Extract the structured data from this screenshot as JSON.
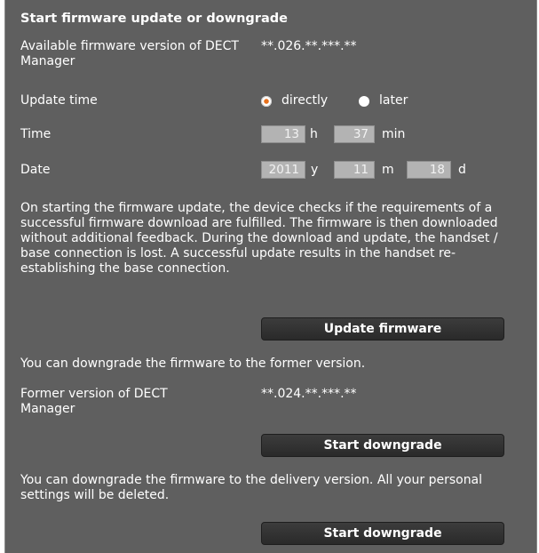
{
  "title": "Start firmware update or downgrade",
  "available_label": "Available firmware version of DECT Manager",
  "available_value": "**.026.**.***.**",
  "update_time": {
    "label": "Update time",
    "options": [
      {
        "label": "directly",
        "checked": true
      },
      {
        "label": "later",
        "checked": false
      }
    ]
  },
  "time": {
    "label": "Time",
    "hours": "13",
    "hours_unit": "h",
    "minutes": "37",
    "minutes_unit": "min"
  },
  "date": {
    "label": "Date",
    "year": "2011",
    "year_unit": "y",
    "month": "11",
    "month_unit": "m",
    "day": "18",
    "day_unit": "d"
  },
  "info_text": "On starting the firmware update, the device checks if the requirements of a successful firmware download are fulfilled. The firmware is then downloaded without additional feedback. During the download and update, the handset / base connection is lost. A successful update results in the handset re-establishing the base connection.",
  "update_button": "Update firmware",
  "downgrade_former_text": "You can downgrade the firmware to the former version.",
  "former_label": "Former version of DECT Manager",
  "former_value": "**.024.**.***.**",
  "downgrade_button_1": "Start downgrade",
  "downgrade_delivery_text": "You can downgrade the firmware to the delivery version. All your personal settings will be deleted.",
  "downgrade_button_2": "Start downgrade"
}
